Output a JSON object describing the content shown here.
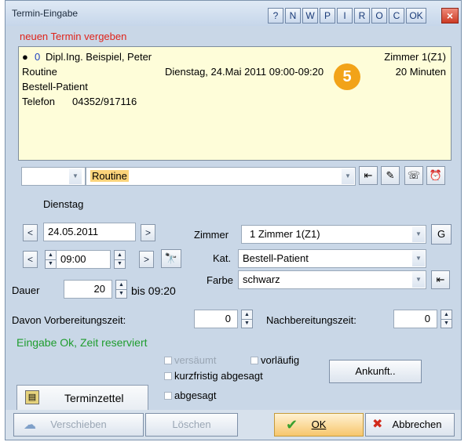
{
  "window": {
    "title": "Termin-Eingabe",
    "toolbar_buttons": [
      "?",
      "N",
      "W",
      "P",
      "I",
      "R",
      "O",
      "C",
      "OK"
    ],
    "close_label": "×"
  },
  "header": {
    "caption": "neuen Termin vergeben"
  },
  "info": {
    "patient_count": "0",
    "patient_name": "Dipl.Ing. Beispiel, Peter",
    "room": "Zimmer 1(Z1)",
    "type": "Routine",
    "datetime": "Dienstag, 24.Mai 2011  09:00-09:20",
    "duration": "20 Minuten",
    "category": "Bestell-Patient",
    "phone_label": "Telefon",
    "phone": "04352/917116",
    "badge": "5"
  },
  "type_row": {
    "selected": "Routine"
  },
  "date": {
    "weekday": "Dienstag",
    "value": "24.05.2011",
    "time": "09:00"
  },
  "dauer": {
    "label": "Dauer",
    "value": "20",
    "bis": "bis 09:20"
  },
  "zimmer": {
    "label": "Zimmer",
    "value": "1 Zimmer 1(Z1)",
    "button": "G"
  },
  "kat": {
    "label": "Kat.",
    "value": "Bestell-Patient"
  },
  "farbe": {
    "label": "Farbe",
    "value": "schwarz"
  },
  "prep": {
    "vor_label": "Davon Vorbereitungszeit:",
    "vor_value": "0",
    "nach_label": "Nachbereitungszeit:",
    "nach_value": "0"
  },
  "status": {
    "text": "Eingabe Ok, Zeit reserviert"
  },
  "checkboxes": {
    "versaeumt": "versäumt",
    "vorlaeufig": "vorläufig",
    "kurzfristig": "kurzfristig abgesagt",
    "abgesagt": "abgesagt"
  },
  "buttons": {
    "ankunft": "Ankunft..",
    "terminzettel": "Terminzettel",
    "verschieben": "Verschieben",
    "loeschen": "Löschen",
    "ok": "OK",
    "abbrechen": "Abbrechen"
  },
  "colors": {
    "accent_badge": "#f2a319",
    "status_green": "#1f9d2f",
    "caption_red": "#e0241b"
  }
}
